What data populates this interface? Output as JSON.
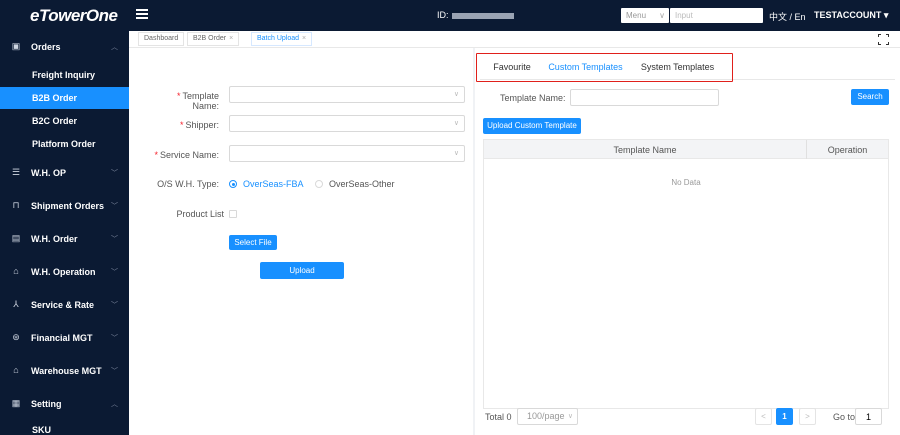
{
  "header": {
    "logo": "eTowerOne",
    "id_label": "ID:",
    "menu_select": "Menu",
    "search_placeholder": "Input",
    "language": "中文 / En",
    "account": "TESTACCOUNT ▾"
  },
  "sidebar": {
    "orders": "Orders",
    "sub_items": [
      "Freight Inquiry",
      "B2B Order",
      "B2C Order",
      "Platform Order"
    ],
    "active_sub": "B2B Order",
    "groups": [
      "W.H. OP",
      "Shipment Orders",
      "W.H. Order",
      "W.H. Operation",
      "Service & Rate",
      "Financial MGT",
      "Warehouse MGT",
      "Setting"
    ],
    "setting_sub": "SKU"
  },
  "page_tabs": [
    {
      "label": "Dashboard",
      "close": ""
    },
    {
      "label": "B2B Order",
      "close": "×"
    },
    {
      "label": "Batch Upload",
      "close": "×"
    }
  ],
  "form": {
    "template_name_label": "Template Name:",
    "shipper_label": "Shipper:",
    "service_name_label": "Service Name:",
    "os_type_label": "O/S W.H. Type:",
    "os_type_options": [
      "OverSeas-FBA",
      "OverSeas-Other"
    ],
    "os_type_selected": "OverSeas-FBA",
    "product_list_label": "Product List",
    "select_file": "Select File",
    "upload": "Upload"
  },
  "templates": {
    "tabs": [
      "Favourite",
      "Custom Templates",
      "System Templates"
    ],
    "active_tab": "Custom Templates",
    "name_label": "Template Name:",
    "search": "Search",
    "upload_custom": "Upload Custom Template",
    "columns": [
      "Template Name",
      "Operation"
    ],
    "no_data": "No Data",
    "pagination": {
      "total": "Total 0",
      "page_size": "100/page",
      "prev": "<",
      "current": "1",
      "next": ">",
      "goto_label": "Go to",
      "goto_value": "1"
    }
  },
  "colors": {
    "sidebar_bg": "#0b1a33",
    "accent": "#1890ff",
    "highlight": "#e0201b"
  }
}
